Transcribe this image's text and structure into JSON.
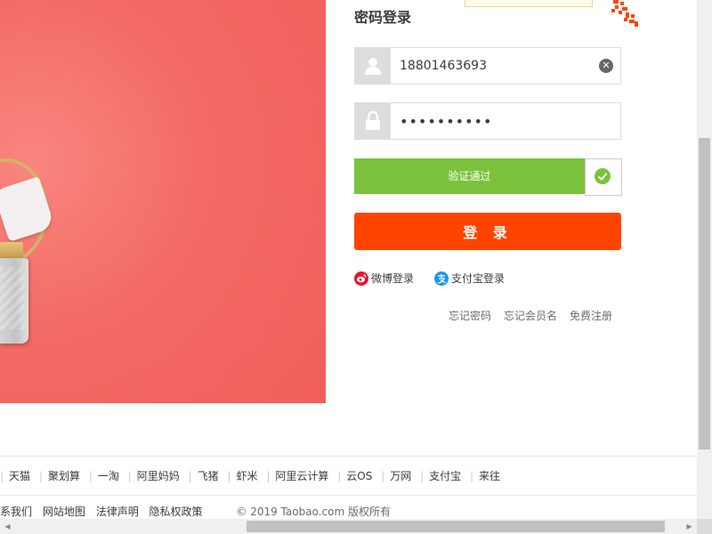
{
  "login": {
    "title": "密码登录",
    "username_value": "18801463693",
    "password_value": "••••••••••",
    "verify_text": "验证通过",
    "submit_label": "登 录",
    "alt_logins": {
      "weibo": "微博登录",
      "alipay": "支付宝登录"
    },
    "links": {
      "forgot_password": "忘记密码",
      "forgot_username": "忘记会员名",
      "register": "免费注册"
    }
  },
  "footer": {
    "nav": [
      "天猫",
      "聚划算",
      "一淘",
      "阿里妈妈",
      "飞猪",
      "虾米",
      "阿里云计算",
      "云OS",
      "万网",
      "支付宝",
      "来往"
    ],
    "legal": [
      "系我们",
      "网站地图",
      "法律声明",
      "隐私权政策"
    ],
    "copyright": "© 2019 Taobao.com 版权所有"
  },
  "icons": {
    "user": "user-icon",
    "lock": "lock-icon",
    "clear": "clear-icon",
    "check": "check-icon",
    "weibo": "weibo-icon",
    "alipay": "alipay-icon",
    "qr": "qr-corner-icon"
  },
  "colors": {
    "accent": "#ff4400",
    "verify_green": "#7ac23c",
    "banner": "#f36a66"
  }
}
